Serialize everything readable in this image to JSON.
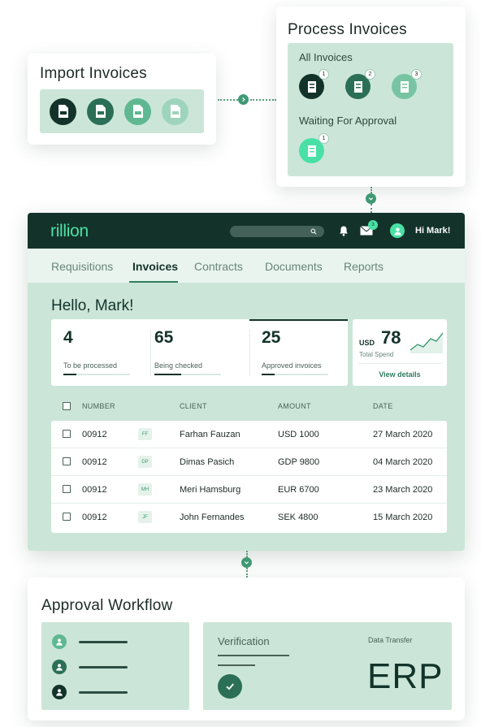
{
  "import": {
    "title": "Import Invoices",
    "file_types": [
      "pdf-file-icon",
      "xml-file-icon",
      "csv-file-icon",
      "doc-file-icon"
    ]
  },
  "process": {
    "title": "Process Invoices",
    "all_label": "All Invoices",
    "waiting_label": "Waiting For Approval",
    "all_badges": [
      "1",
      "2",
      "3"
    ],
    "waiting_badges": [
      "1"
    ]
  },
  "app": {
    "logo": "rillion",
    "greeting_top": "Hi Mark!",
    "mail_count": "3",
    "nav": [
      "Requisitions",
      "Invoices",
      "Contracts",
      "Documents",
      "Reports"
    ],
    "active_nav": "Invoices",
    "hello": "Hello, Mark!",
    "stats": [
      {
        "value": "4",
        "label": "To be processed",
        "progress": 0.2
      },
      {
        "value": "65",
        "label": "Being checked",
        "progress": 0.4
      },
      {
        "value": "25",
        "label": "Approved invoices",
        "progress": 0.2
      }
    ],
    "spend": {
      "currency": "USD",
      "value": "78",
      "label": "Total Spend",
      "link": "View details"
    },
    "table": {
      "headers": [
        "NUMBER",
        "CLIENT",
        "AMOUNT",
        "DATE"
      ],
      "rows": [
        {
          "number": "00912",
          "initials": "FF",
          "client": "Farhan Fauzan",
          "amount": "USD 1000",
          "date": "27 March 2020"
        },
        {
          "number": "00912",
          "initials": "DP",
          "client": "Dimas Pasich",
          "amount": "GDP 9800",
          "date": "04 March 2020"
        },
        {
          "number": "00912",
          "initials": "MH",
          "client": "Meri Hamsburg",
          "amount": "EUR 6700",
          "date": "23 March 2020"
        },
        {
          "number": "00912",
          "initials": "JF",
          "client": "John Fernandes",
          "amount": "SEK 4800",
          "date": "15 March 2020"
        }
      ]
    }
  },
  "approval": {
    "title": "Approval Workflow",
    "verification_label": "Verification",
    "data_transfer_label": "Data Transfer",
    "erp_label": "ERP"
  },
  "colors": {
    "dark_green": "#13332a",
    "tray_green": "#cbe6d8",
    "mint_accent": "#49e0a6",
    "mid_green": "#3f9a74"
  }
}
